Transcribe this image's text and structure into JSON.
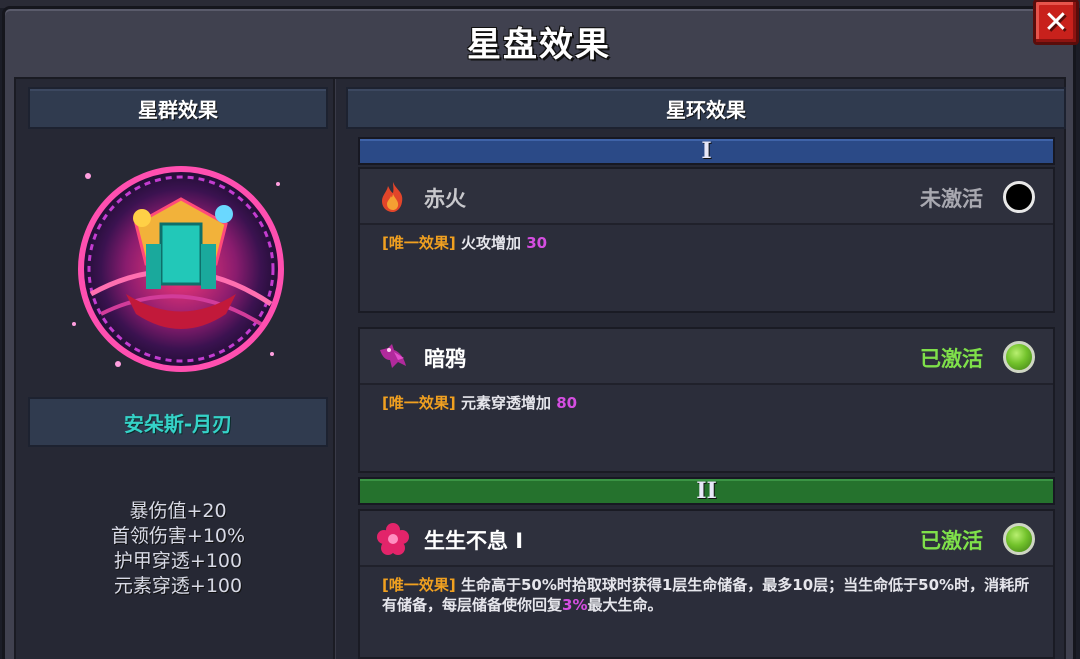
{
  "window": {
    "title": "星盘效果"
  },
  "left": {
    "header": "星群效果",
    "constellation_name": "安朵斯-月刃",
    "stats": [
      "暴伤值+20",
      "首领伤害+10%",
      "护甲穿透+100",
      "元素穿透+100"
    ]
  },
  "right": {
    "header": "星环效果",
    "tiers": [
      {
        "label": "I"
      },
      {
        "label": "II"
      }
    ],
    "effects": [
      {
        "name": "赤火",
        "status": "未激活",
        "icon": "fire-icon",
        "tag": "[唯一效果]",
        "desc": "火攻增加",
        "value": "30"
      },
      {
        "name": "暗鸦",
        "status": "已激活",
        "icon": "crow-icon",
        "tag": "[唯一效果]",
        "desc": "元素穿透增加",
        "value": "80"
      },
      {
        "name": "生生不息 I",
        "status": "已激活",
        "icon": "flower-icon",
        "tag": "[唯一效果]",
        "desc_before": "生命高于50%时拾取球时获得1层生命储备，最多10层；当生命低于50%时，消耗所有储备，每层储备使你回复",
        "value": "3%",
        "desc_after": "最大生命。"
      }
    ]
  },
  "colors": {
    "inactive_status": "#a8a8b0",
    "active_status": "#7fe04a",
    "tag": "#f0a020",
    "value": "#d44ee0",
    "constellation_name": "#35d2c8",
    "tier1": "#2b4a87",
    "tier2": "#25722d"
  }
}
